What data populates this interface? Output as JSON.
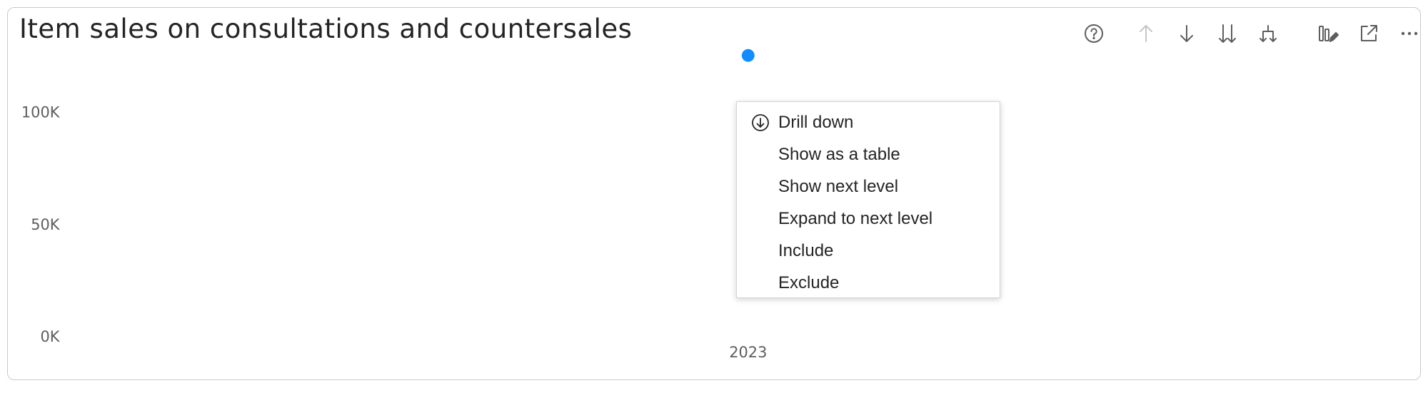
{
  "visual": {
    "title": "Item sales on consultations and countersales"
  },
  "toolbar": {
    "icons": [
      {
        "name": "help-icon",
        "label": "Help",
        "state": "enabled"
      },
      {
        "name": "drill-up-icon",
        "label": "Drill up",
        "state": "disabled"
      },
      {
        "name": "drill-down-icon",
        "label": "Turn on drill down",
        "state": "enabled"
      },
      {
        "name": "go-to-next-level-icon",
        "label": "Go to the next level in the hierarchy",
        "state": "enabled"
      },
      {
        "name": "expand-all-down-icon",
        "label": "Expand all down one level in the hierarchy",
        "state": "enabled"
      },
      {
        "name": "format-visual-icon",
        "label": "Format",
        "state": "enabled"
      },
      {
        "name": "focus-mode-icon",
        "label": "Focus mode",
        "state": "enabled"
      },
      {
        "name": "more-options-icon",
        "label": "More options",
        "state": "enabled"
      }
    ]
  },
  "chart_data": {
    "type": "scatter",
    "title": "Item sales on consultations and countersales",
    "categories": [
      "2023"
    ],
    "series": [
      {
        "values": [
          125000
        ]
      }
    ],
    "y_ticks": [
      "100K",
      "50K",
      "0K"
    ],
    "ylim": [
      0,
      100000
    ],
    "x_ticks": [
      "2023"
    ],
    "grid": false,
    "legend": "none",
    "marker_color": "#118dff"
  },
  "context_menu": {
    "items": [
      {
        "label": "Drill down",
        "icon": "drill-down-circle-icon"
      },
      {
        "label": "Show as a table",
        "icon": ""
      },
      {
        "label": "Show next level",
        "icon": ""
      },
      {
        "label": "Expand to next level",
        "icon": ""
      },
      {
        "label": "Include",
        "icon": ""
      },
      {
        "label": "Exclude",
        "icon": ""
      }
    ]
  },
  "colors": {
    "text": "#252423",
    "axis_text": "#605e5c",
    "icon": "#605e5c",
    "icon_disabled": "#c8c6c4",
    "border": "#c8c8c8",
    "accent": "#118dff"
  }
}
